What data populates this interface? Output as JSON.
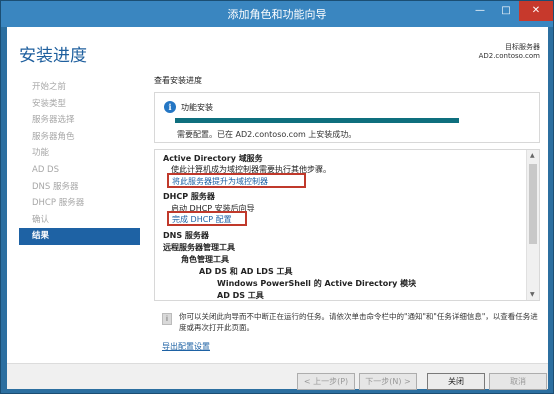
{
  "window": {
    "title": "添加角色和功能向导",
    "minimize_glyph": "—",
    "maximize_glyph": "□",
    "close_glyph": "✕"
  },
  "header": {
    "title": "安装进度",
    "target_label": "目标服务器",
    "target_server": "AD2.contoso.com"
  },
  "nav": {
    "items": [
      {
        "label": "开始之前",
        "active": false
      },
      {
        "label": "安装类型",
        "active": false
      },
      {
        "label": "服务器选择",
        "active": false
      },
      {
        "label": "服务器角色",
        "active": false
      },
      {
        "label": "功能",
        "active": false
      },
      {
        "label": "AD DS",
        "active": false
      },
      {
        "label": "DNS 服务器",
        "active": false
      },
      {
        "label": "DHCP 服务器",
        "active": false
      },
      {
        "label": "确认",
        "active": false
      },
      {
        "label": "结果",
        "active": true
      }
    ]
  },
  "progress": {
    "section_label": "查看安装进度",
    "info_glyph": "i",
    "title": "功能安装",
    "percent": 100,
    "message": "需要配置。已在 AD2.contoso.com 上安装成功。"
  },
  "results": {
    "ad_title": "Active Directory 域服务",
    "ad_desc": "使此计算机成为域控制器需要执行其他步骤。",
    "ad_link": "将此服务器提升为域控制器",
    "dhcp_title": "DHCP 服务器",
    "dhcp_desc": "启动 DHCP 安装后向导",
    "dhcp_link": "完成 DHCP 配置",
    "dns_title": "DNS 服务器",
    "rsat_title": "远程服务器管理工具",
    "role_tools": "角色管理工具",
    "adds_tools": "AD DS 和 AD LDS 工具",
    "ps_module": "Windows PowerShell 的 Active Directory 模块",
    "ad_ds_tools": "AD DS 工具"
  },
  "scrollbar": {
    "up_glyph": "▲",
    "down_glyph": "▼"
  },
  "note": {
    "icon_glyph": "i",
    "text": "你可以关闭此向导而不中断正在运行的任务。请依次单击命令栏中的\"通知\"和\"任务详细信息\"，以查看任务进度或再次打开此页面。"
  },
  "export_link": "导出配置设置",
  "buttons": {
    "prev": "< 上一步(P)",
    "next": "下一步(N) >",
    "close": "关闭",
    "cancel": "取消"
  }
}
